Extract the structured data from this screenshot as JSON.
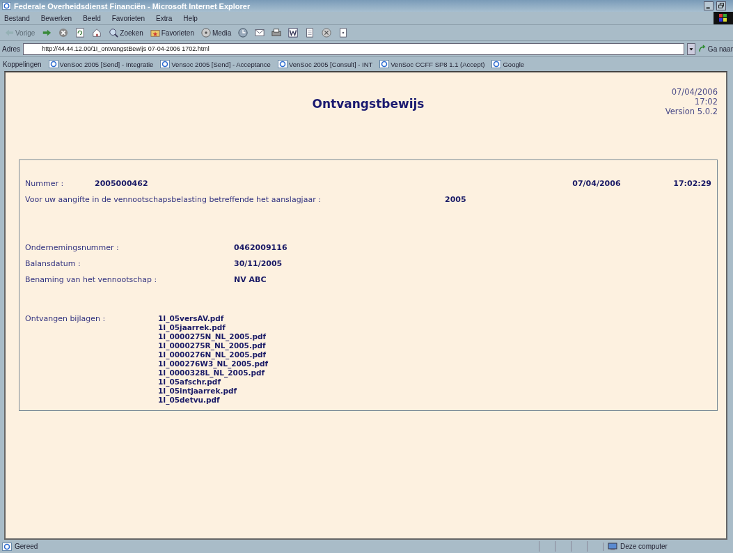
{
  "window": {
    "title": "Federale Overheidsdienst Financiën - Microsoft Internet Explorer"
  },
  "menu": [
    "Bestand",
    "Bewerken",
    "Beeld",
    "Favorieten",
    "Extra",
    "Help"
  ],
  "toolbar": [
    {
      "kind": "back",
      "label": "Vorige",
      "disabled": true
    },
    {
      "kind": "forward"
    },
    {
      "kind": "stop"
    },
    {
      "kind": "refresh"
    },
    {
      "kind": "home"
    },
    {
      "kind": "search",
      "label": "Zoeken"
    },
    {
      "kind": "favorites",
      "label": "Favorieten"
    },
    {
      "kind": "media",
      "label": "Media"
    },
    {
      "kind": "history"
    },
    {
      "kind": "mail"
    },
    {
      "kind": "print"
    },
    {
      "kind": "word"
    },
    {
      "kind": "edit"
    },
    {
      "kind": "messenger"
    },
    {
      "kind": "research"
    }
  ],
  "address": {
    "label": "Adres",
    "value": "http://44.44.12.00/1I_ontvangstBewijs 07-04-2006 1702.html",
    "go": "Ga naar"
  },
  "links": {
    "label": "Koppelingen",
    "items": [
      "VenSoc 2005 [Send] - Integratie",
      "Vensoc 2005 [Send] - Acceptance",
      "VenSoc 2005 [Consult] - INT",
      "VenSoc CCFF SP8 1.1 (Accept)",
      "Google"
    ]
  },
  "page": {
    "title": "Ontvangstbewijs",
    "meta": [
      "07/04/2006",
      "17:02",
      "Version 5.0.2"
    ],
    "number": {
      "label": "Nummer :",
      "value": "2005000462",
      "date": "07/04/2006",
      "time": "17:02:29"
    },
    "declaration": {
      "label": "Voor uw aangifte in de vennootschapsbelasting betreffende het aanslagjaar :",
      "value": "2005"
    },
    "fields": [
      {
        "label": "Ondernemingsnummer :",
        "value": "0462009116"
      },
      {
        "label": "Balansdatum :",
        "value": "30/11/2005"
      },
      {
        "label": "Benaming van het vennootschap :",
        "value": "NV ABC"
      }
    ],
    "attachments": {
      "label": "Ontvangen bijlagen :",
      "files": [
        "1I_05versAV.pdf",
        "1I_05jaarrek.pdf",
        "1I_0000275N_NL_2005.pdf",
        "1I_0000275R_NL_2005.pdf",
        "1I_0000276N_NL_2005.pdf",
        "1I_000276W3_NL_2005.pdf",
        "1I_0000328L_NL_2005.pdf",
        "1I_05afschr.pdf",
        "1I_05intjaarrek.pdf",
        "1I_05detvu.pdf"
      ]
    }
  },
  "status_bar": {
    "text": "Gereed",
    "zone": "Deze computer"
  }
}
